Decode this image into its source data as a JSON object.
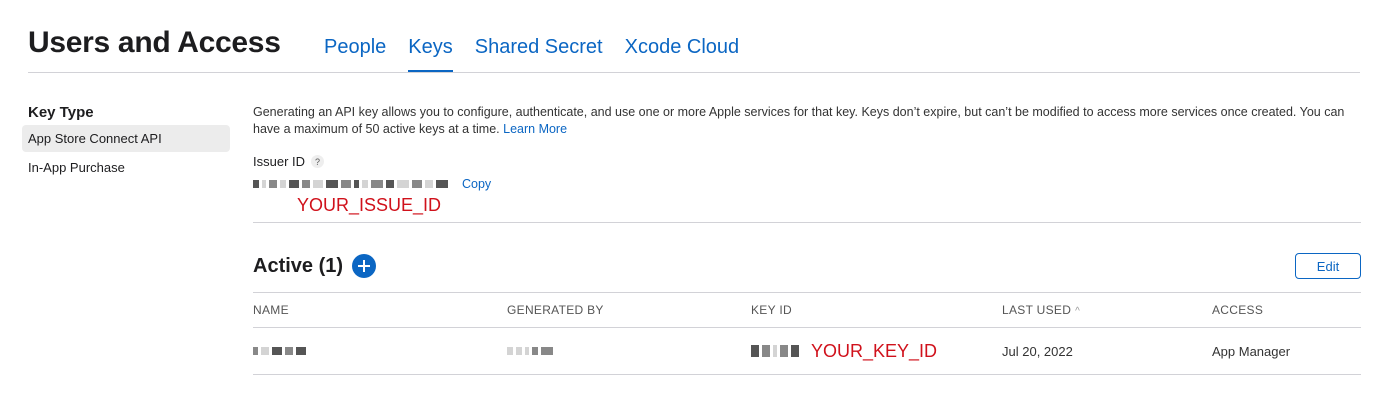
{
  "header": {
    "title": "Users and Access",
    "tabs": [
      {
        "label": "People",
        "active": false
      },
      {
        "label": "Keys",
        "active": true
      },
      {
        "label": "Shared Secret",
        "active": false
      },
      {
        "label": "Xcode Cloud",
        "active": false
      }
    ]
  },
  "sidebar": {
    "title": "Key Type",
    "items": [
      {
        "label": "App Store Connect API",
        "selected": true
      },
      {
        "label": "In-App Purchase",
        "selected": false
      }
    ]
  },
  "main": {
    "description": "Generating an API key allows you to configure, authenticate, and use one or more Apple services for that key. Keys don’t expire, but can’t be modified to access more services once created. You can have a maximum of 50 active keys at a time.",
    "learn_more": "Learn More",
    "issuer_label": "Issuer ID",
    "help_glyph": "?",
    "copy_label": "Copy",
    "issuer_redaction_label": "YOUR_ISSUE_ID",
    "active_title": "Active (1)",
    "edit_label": "Edit",
    "table": {
      "columns": [
        "NAME",
        "GENERATED BY",
        "KEY ID",
        "LAST USED",
        "ACCESS"
      ],
      "sort_glyph": "^",
      "rows": [
        {
          "key_id_label": "YOUR_KEY_ID",
          "last_used": "Jul 20, 2022",
          "access": "App Manager"
        }
      ]
    }
  },
  "colors": {
    "accent": "#0b66c3",
    "redaction": "#d0111b",
    "divider": "#d2d2d7"
  },
  "icons": {
    "help": "question-mark-icon",
    "add": "plus-circle-icon",
    "sort": "chevron-up-icon"
  }
}
